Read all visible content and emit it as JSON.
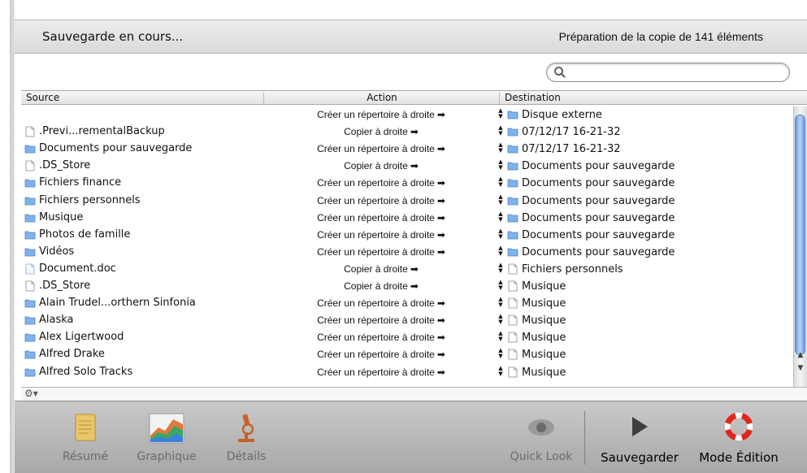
{
  "header": {
    "status_left": "Sauvegarde en cours...",
    "status_right": "Préparation de la copie de 141 éléments"
  },
  "search": {
    "placeholder": "",
    "value": ""
  },
  "table": {
    "columns": {
      "source": "Source",
      "action": "Action",
      "destination": "Destination"
    },
    "rows": [
      {
        "source": "",
        "source_icon": "",
        "action": "Créer un répertoire à droite",
        "dest": "Disque externe",
        "dest_icon": "folder-icon"
      },
      {
        "source": ".Previ...rementalBackup",
        "source_icon": "document-icon",
        "action": "Copier à droite",
        "dest": "07/12/17 16-21-32",
        "dest_icon": "folder-icon"
      },
      {
        "source": "Documents pour sauvegarde",
        "source_icon": "folder-icon",
        "action": "Créer un répertoire à droite",
        "dest": "07/12/17 16-21-32",
        "dest_icon": "folder-icon"
      },
      {
        "source": ".DS_Store",
        "source_icon": "document-icon",
        "action": "Copier à droite",
        "dest": "Documents pour sauvegarde",
        "dest_icon": "folder-icon"
      },
      {
        "source": "Fichiers finance",
        "source_icon": "folder-icon",
        "action": "Créer un répertoire à droite",
        "dest": "Documents pour sauvegarde",
        "dest_icon": "folder-icon"
      },
      {
        "source": "Fichiers personnels",
        "source_icon": "folder-icon",
        "action": "Créer un répertoire à droite",
        "dest": "Documents pour sauvegarde",
        "dest_icon": "folder-icon"
      },
      {
        "source": "Musique",
        "source_icon": "folder-icon",
        "action": "Créer un répertoire à droite",
        "dest": "Documents pour sauvegarde",
        "dest_icon": "folder-icon"
      },
      {
        "source": "Photos de famille",
        "source_icon": "folder-icon",
        "action": "Créer un répertoire à droite",
        "dest": "Documents pour sauvegarde",
        "dest_icon": "folder-icon"
      },
      {
        "source": "Vidéos",
        "source_icon": "folder-icon",
        "action": "Créer un répertoire à droite",
        "dest": "Documents pour sauvegarde",
        "dest_icon": "folder-icon"
      },
      {
        "source": "Document.doc",
        "source_icon": "word-document-icon",
        "action": "Copier à droite",
        "dest": "Fichiers personnels",
        "dest_icon": "document-icon"
      },
      {
        "source": ".DS_Store",
        "source_icon": "document-icon",
        "action": "Copier à droite",
        "dest": "Musique",
        "dest_icon": "document-icon"
      },
      {
        "source": "Alain Trudel...orthern Sinfonia",
        "source_icon": "folder-icon",
        "action": "Créer un répertoire à droite",
        "dest": "Musique",
        "dest_icon": "document-icon"
      },
      {
        "source": "Alaska",
        "source_icon": "folder-icon",
        "action": "Créer un répertoire à droite",
        "dest": "Musique",
        "dest_icon": "document-icon"
      },
      {
        "source": "Alex Ligertwood",
        "source_icon": "folder-icon",
        "action": "Créer un répertoire à droite",
        "dest": "Musique",
        "dest_icon": "document-icon"
      },
      {
        "source": "Alfred Drake",
        "source_icon": "folder-icon",
        "action": "Créer un répertoire à droite",
        "dest": "Musique",
        "dest_icon": "document-icon"
      },
      {
        "source": "Alfred Solo Tracks",
        "source_icon": "folder-icon",
        "action": "Créer un répertoire à droite",
        "dest": "Musique",
        "dest_icon": "document-icon"
      }
    ]
  },
  "toolbar": {
    "summary_label": "Résumé",
    "chart_label": "Graphique",
    "details_label": "Détails",
    "quicklook_label": "Quick Look",
    "backup_label": "Sauvegarder",
    "edit_mode_label": "Mode Édition"
  },
  "icons": {
    "summary": "notepad-icon",
    "chart": "area-chart-icon",
    "details": "microscope-icon",
    "quicklook": "eye-icon",
    "backup": "play-icon",
    "edit_mode": "lifebuoy-icon",
    "gear": "gear-icon",
    "search": "search-icon"
  },
  "colors": {
    "folder": "#7fb2ea",
    "scroll_thumb": "#6c9be0",
    "lifebuoy": "#e0261d",
    "toolbar_bg": "#b8b8b8"
  }
}
